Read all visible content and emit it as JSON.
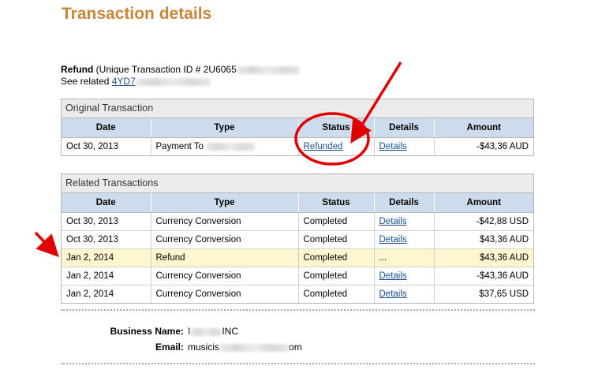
{
  "page": {
    "title": "Transaction details"
  },
  "refund": {
    "label": "Refund",
    "id_prefix": "(Unique Transaction ID # 2U6065",
    "id_suffix": "",
    "see_related": "See related ",
    "related_link": "4YD7"
  },
  "original": {
    "section_title": "Original Transaction",
    "headers": [
      "Date",
      "Type",
      "Status",
      "Details",
      "Amount"
    ],
    "rows": [
      {
        "date": "Oct 30, 2013",
        "type": "Payment To",
        "status": "Refunded",
        "details": "Details",
        "amount": "-$43,36 AUD"
      }
    ]
  },
  "related": {
    "section_title": "Related Transactions",
    "headers": [
      "Date",
      "Type",
      "Status",
      "Details",
      "Amount"
    ],
    "rows": [
      {
        "date": "Oct 30, 2013",
        "type": "Currency Conversion",
        "status": "Completed",
        "details": "Details",
        "amount": "-$42,88 USD"
      },
      {
        "date": "Oct 30, 2013",
        "type": "Currency Conversion",
        "status": "Completed",
        "details": "Details",
        "amount": "$43,36 AUD"
      },
      {
        "date": "Jan 2, 2014",
        "type": "Refund",
        "status": "Completed",
        "details": "...",
        "amount": "$43,36 AUD"
      },
      {
        "date": "Jan 2, 2014",
        "type": "Currency Conversion",
        "status": "Completed",
        "details": "Details",
        "amount": "-$43,36 AUD"
      },
      {
        "date": "Jan 2, 2014",
        "type": "Currency Conversion",
        "status": "Completed",
        "details": "Details",
        "amount": "$37,65 USD"
      }
    ]
  },
  "business": {
    "name_label": "Business Name:",
    "name_value_start": "I",
    "name_value_end": "INC",
    "email_label": "Email:",
    "email_value_start": "musicis",
    "email_value_end": "om"
  },
  "colors": {
    "title": "#c8873a",
    "header_bg": "#ccdcec",
    "highlight_row": "#fdf7cf",
    "link": "#1a4f8b",
    "annotation": "#e00000"
  }
}
